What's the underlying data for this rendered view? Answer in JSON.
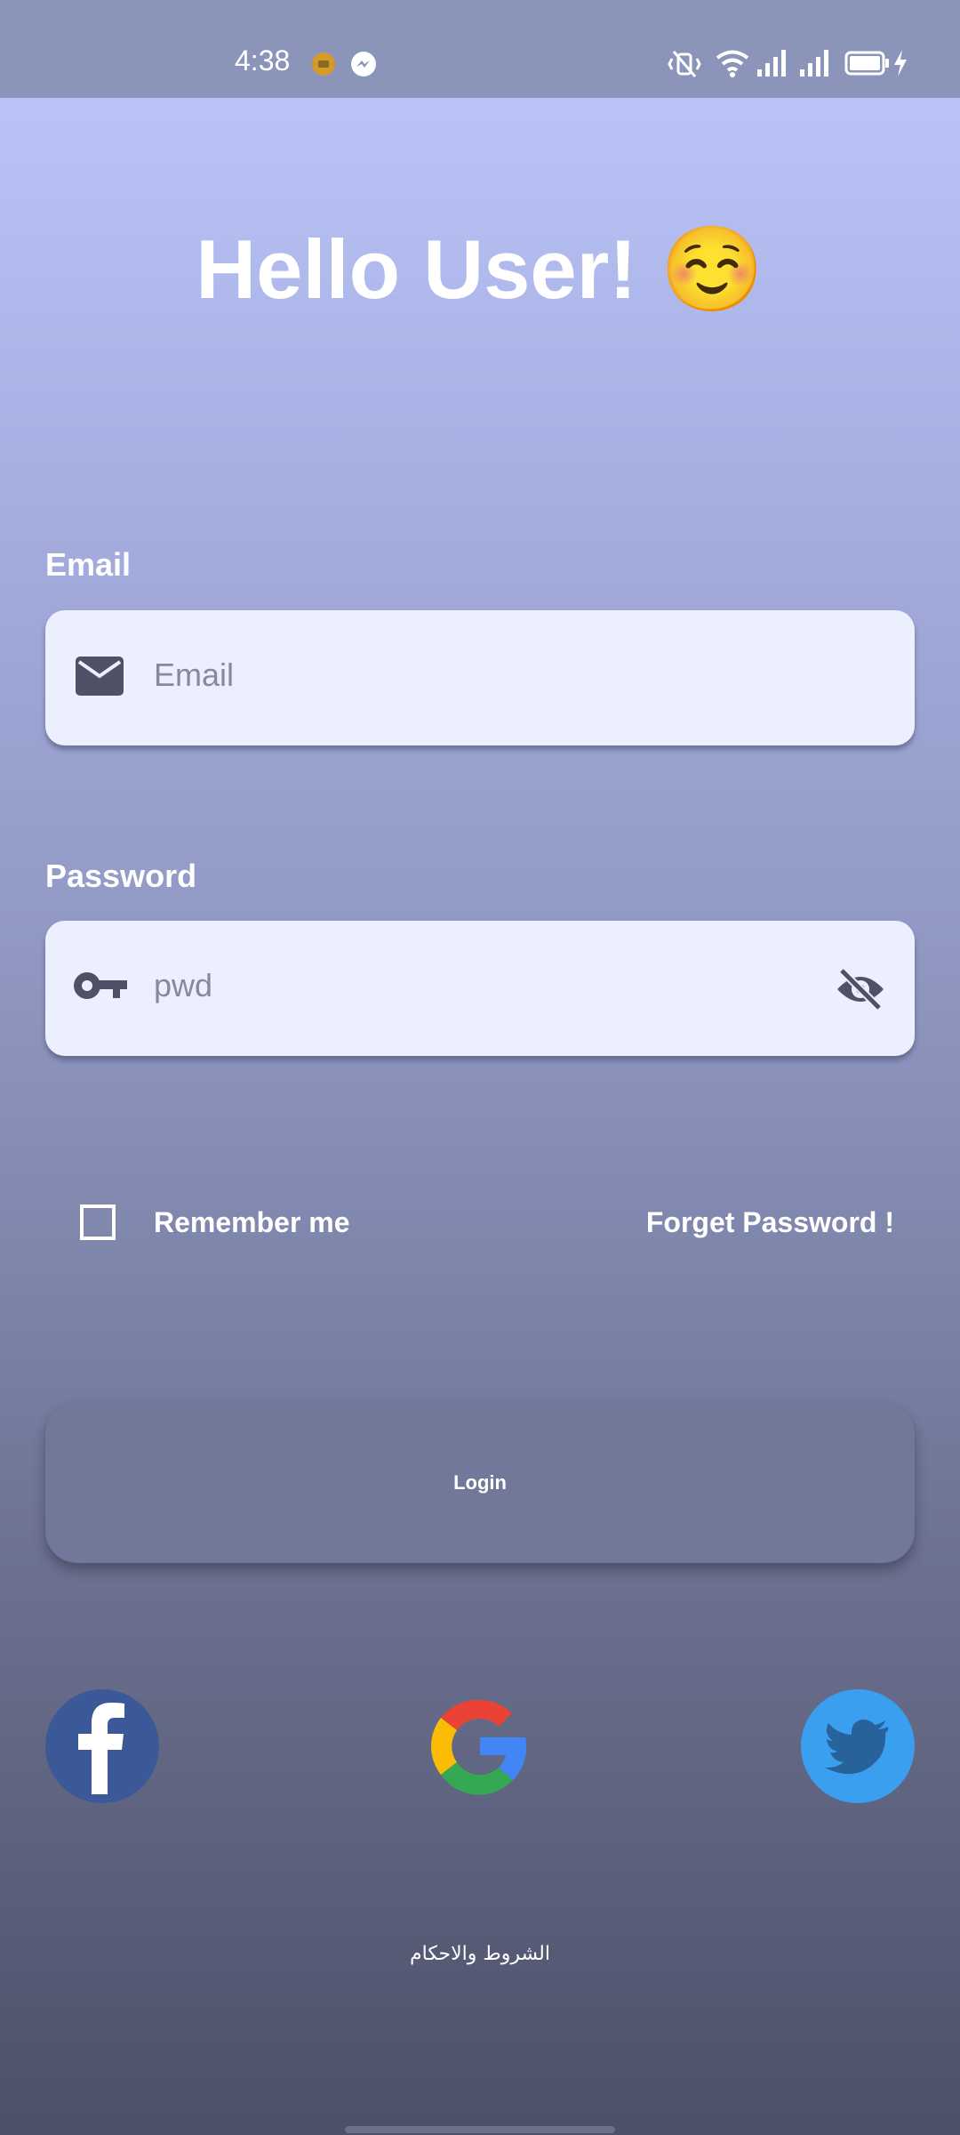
{
  "status_bar": {
    "time": "4:38",
    "icons": [
      "notification-dot-icon",
      "messenger-icon",
      "vibrate-icon",
      "wifi-icon",
      "signal-icon",
      "signal-icon",
      "battery-icon",
      "charging-icon"
    ]
  },
  "header": {
    "title": "Hello User! ☺️"
  },
  "email": {
    "label": "Email",
    "placeholder": "Email",
    "icon": "mail-icon"
  },
  "password": {
    "label": "Password",
    "placeholder": "pwd",
    "icon": "key-icon",
    "toggle_icon": "eye-off-icon"
  },
  "options": {
    "remember_label": "Remember me",
    "remember_checked": false,
    "forgot_label": "Forget Password !"
  },
  "login": {
    "label": "Login"
  },
  "social": {
    "items": [
      "facebook-icon",
      "google-icon",
      "twitter-icon"
    ],
    "colors": {
      "facebook": "#3b5998",
      "twitter": "#3b9ff0"
    }
  },
  "footer": {
    "terms": "الشروط والاحكام"
  }
}
